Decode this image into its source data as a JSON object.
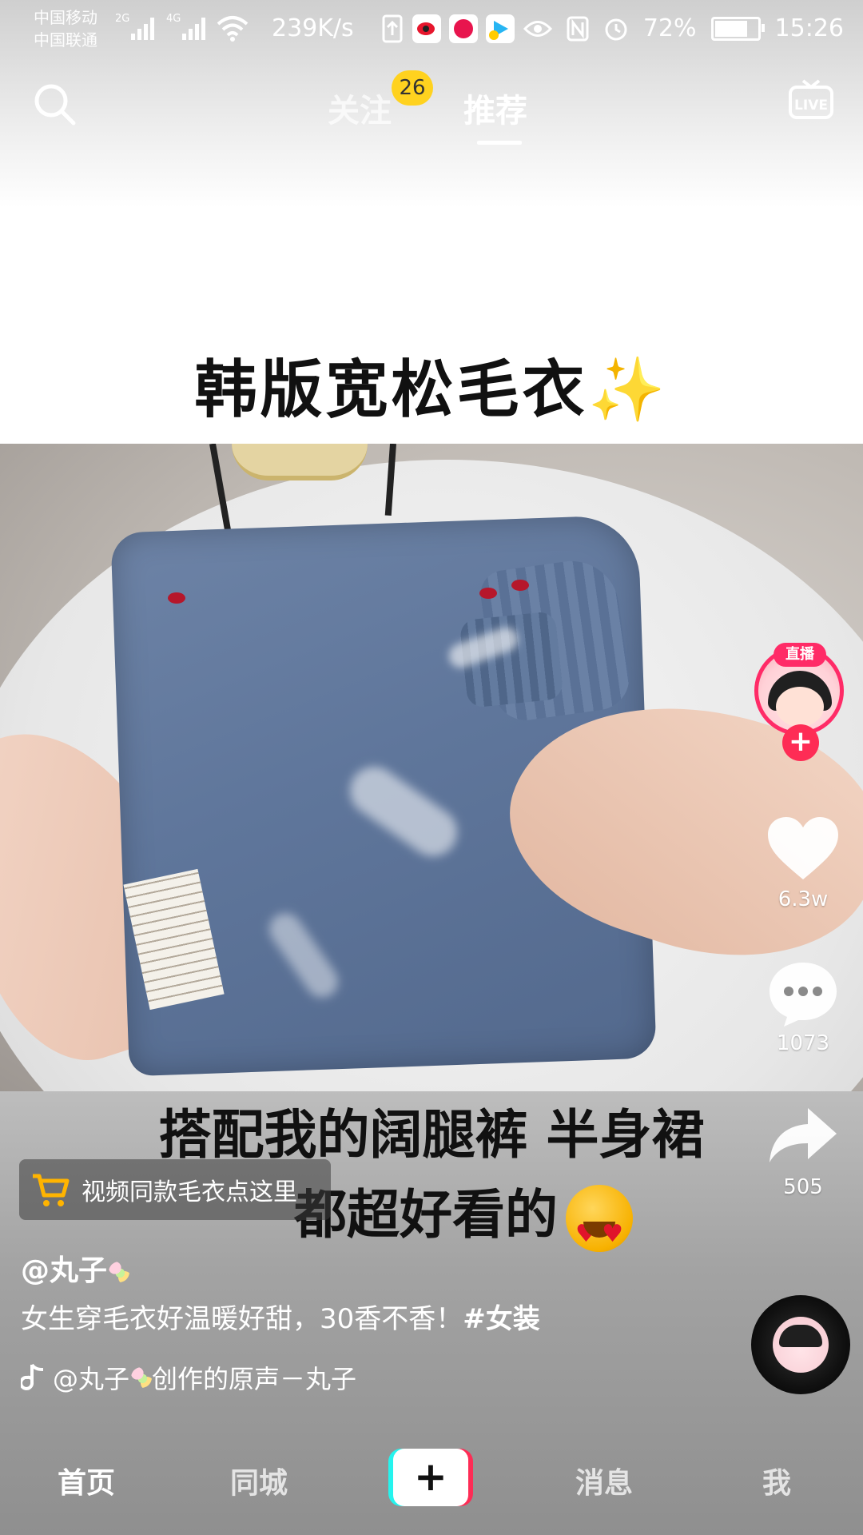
{
  "status_bar": {
    "carrier1": "中国移动",
    "carrier2": "中国联通",
    "net1": "2G",
    "net2": "4G",
    "speed": "239K/s",
    "battery": "72%",
    "battery_level": 0.72,
    "time": "15:26"
  },
  "top_nav": {
    "follow_label": "关注",
    "follow_badge": "26",
    "recommend_label": "推荐",
    "live_label": "LIVE",
    "search_icon": "search-icon"
  },
  "video": {
    "overlay_title": "韩版宽松毛衣✨",
    "caption_line1": "搭配我的阔腿裤 半身裙",
    "caption_line2": "都超好看的"
  },
  "right_rail": {
    "live_tag": "直播",
    "follow_plus": "+",
    "likes": "6.3w",
    "comments": "1073",
    "shares": "505"
  },
  "cart": {
    "label": "视频同款毛衣点这里"
  },
  "post": {
    "author": "@丸子",
    "description": "女生穿毛衣好温暖好甜，30香不香！",
    "hashtag": "#女装",
    "music": "@丸子",
    "music_suffix": "创作的原声－丸子"
  },
  "bottom_nav": {
    "home": "首页",
    "nearby": "同城",
    "create": "+",
    "messages": "消息",
    "me": "我"
  },
  "colors": {
    "accent": "#fe2c55",
    "teal": "#25f4ee",
    "badge": "#ffd21f"
  }
}
